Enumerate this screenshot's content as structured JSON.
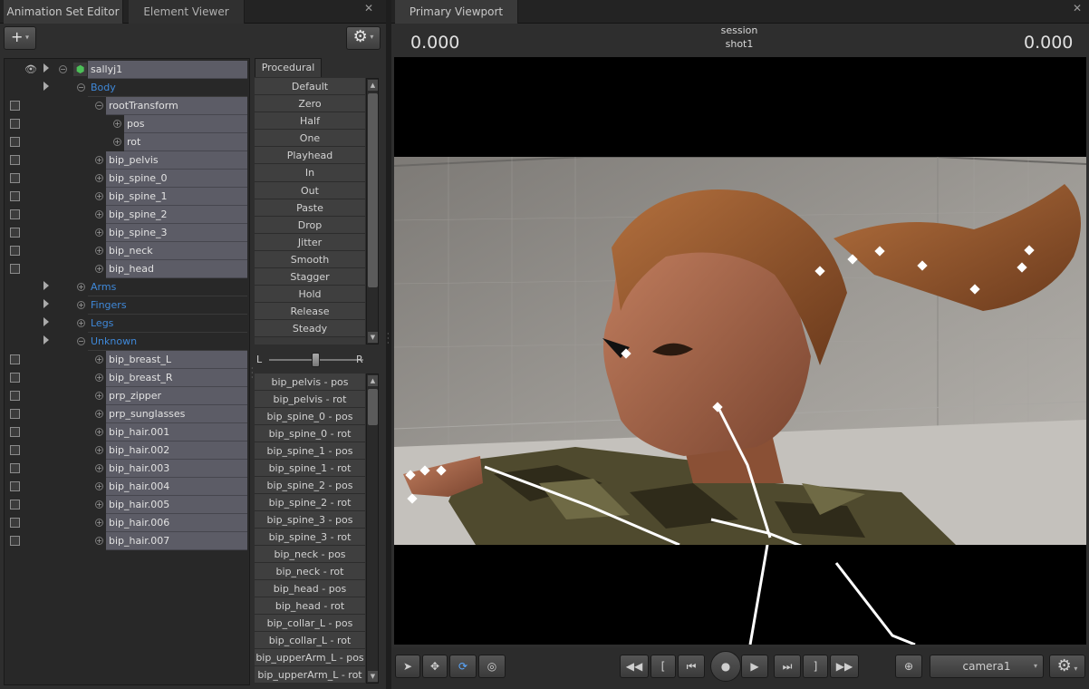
{
  "left_panel": {
    "tabs": [
      {
        "label": "Animation Set Editor"
      },
      {
        "label": "Element Viewer"
      }
    ],
    "toolbar": {
      "add_label": "+",
      "settings_label": "⚙"
    },
    "tree": {
      "root": "sallyj1",
      "rows": [
        {
          "label": "Body",
          "group": true
        },
        {
          "label": "rootTransform"
        },
        {
          "label": "pos"
        },
        {
          "label": "rot"
        },
        {
          "label": "bip_pelvis"
        },
        {
          "label": "bip_spine_0"
        },
        {
          "label": "bip_spine_1"
        },
        {
          "label": "bip_spine_2"
        },
        {
          "label": "bip_spine_3"
        },
        {
          "label": "bip_neck"
        },
        {
          "label": "bip_head"
        },
        {
          "label": "Arms",
          "group": true
        },
        {
          "label": "Fingers",
          "group": true
        },
        {
          "label": "Legs",
          "group": true
        },
        {
          "label": "Unknown",
          "group": true
        },
        {
          "label": "bip_breast_L"
        },
        {
          "label": "bip_breast_R"
        },
        {
          "label": "prp_zipper"
        },
        {
          "label": "prp_sunglasses"
        },
        {
          "label": "bip_hair.001"
        },
        {
          "label": "bip_hair.002"
        },
        {
          "label": "bip_hair.003"
        },
        {
          "label": "bip_hair.004"
        },
        {
          "label": "bip_hair.005"
        },
        {
          "label": "bip_hair.006"
        },
        {
          "label": "bip_hair.007"
        }
      ]
    },
    "procedural": {
      "tab_label": "Procedural",
      "presets": [
        "Default",
        "Zero",
        "Half",
        "One",
        "Playhead",
        "In",
        "Out",
        "Paste",
        "Drop",
        "Jitter",
        "Smooth",
        "Stagger",
        "Hold",
        "Release",
        "Steady"
      ],
      "slider": {
        "left_label": "L",
        "right_label": "R",
        "value": 0.5
      }
    },
    "channels": [
      "bip_pelvis - pos",
      "bip_pelvis - rot",
      "bip_spine_0 - pos",
      "bip_spine_0 - rot",
      "bip_spine_1 - pos",
      "bip_spine_1 - rot",
      "bip_spine_2 - pos",
      "bip_spine_2 - rot",
      "bip_spine_3 - pos",
      "bip_spine_3 - rot",
      "bip_neck - pos",
      "bip_neck - rot",
      "bip_head - pos",
      "bip_head - rot",
      "bip_collar_L - pos",
      "bip_collar_L - rot",
      "bip_upperArm_L - pos",
      "bip_upperArm_L - rot"
    ]
  },
  "viewport": {
    "tab_label": "Primary Viewport",
    "time_left": "0.000",
    "time_right": "0.000",
    "session_label": "session",
    "shot_label": "shot1",
    "camera": "camera1"
  },
  "colors": {
    "accent_group": "#3f88d8",
    "row_bg": "#5c5c66",
    "panel_bg": "#2e2e2e"
  }
}
